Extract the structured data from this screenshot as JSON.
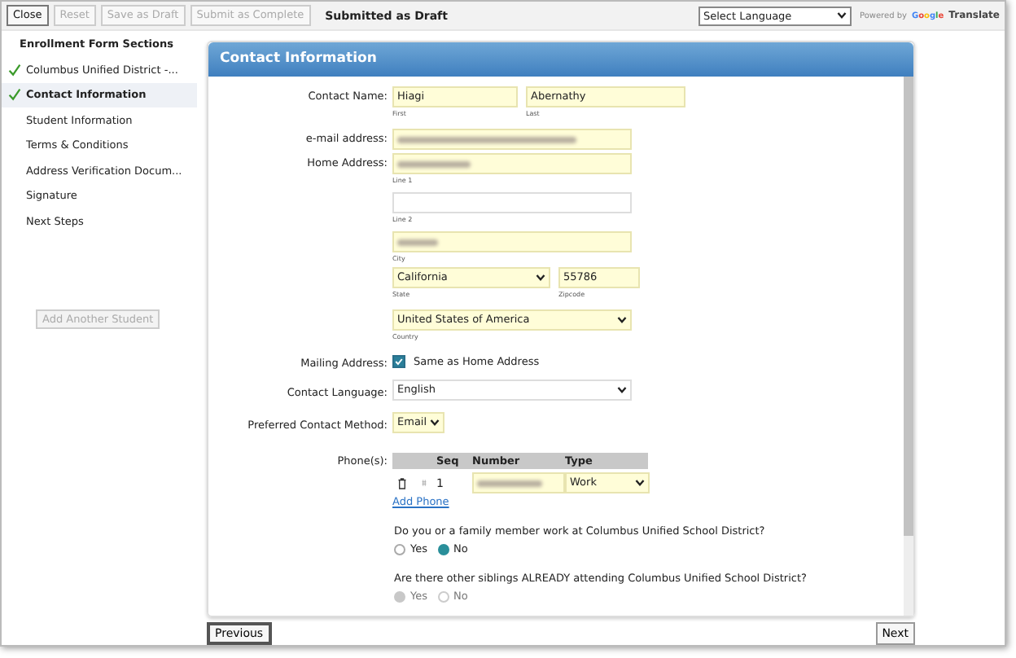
{
  "toolbar": {
    "buttons": [
      {
        "label": "Close",
        "disabled": false
      },
      {
        "label": "Reset",
        "disabled": true
      },
      {
        "label": "Save as Draft",
        "disabled": true
      },
      {
        "label": "Submit as Complete",
        "disabled": true
      }
    ],
    "status": "Submitted as Draft",
    "language_select": "Select Language",
    "powered_by": "Powered by",
    "google": "Google",
    "translate": "Translate"
  },
  "sidebar": {
    "title": "Enrollment Form Sections",
    "items": [
      {
        "label": "Columbus Unified District -...",
        "checked": true,
        "selected": false
      },
      {
        "label": "Contact Information",
        "checked": true,
        "selected": true
      },
      {
        "label": "Student Information",
        "checked": false,
        "selected": false
      },
      {
        "label": "Terms & Conditions",
        "checked": false,
        "selected": false
      },
      {
        "label": "Address Verification Docum...",
        "checked": false,
        "selected": false
      },
      {
        "label": "Signature",
        "checked": false,
        "selected": false
      },
      {
        "label": "Next Steps",
        "checked": false,
        "selected": false
      }
    ],
    "add_button": {
      "label": "Add Another Student",
      "disabled": true
    }
  },
  "panel": {
    "title": "Contact Information",
    "contact_name": {
      "label": "Contact Name:",
      "first": {
        "value": "Hiagi",
        "hint": "First"
      },
      "last": {
        "value": "Abernathy",
        "hint": "Last"
      }
    },
    "email": {
      "label": "e-mail address:",
      "redacted": true
    },
    "home_address": {
      "label": "Home Address:",
      "line1": {
        "hint": "Line 1",
        "redacted": true
      },
      "line2": {
        "hint": "Line 2",
        "redacted": false
      },
      "city": {
        "hint": "City",
        "redacted": true
      },
      "state": {
        "value": "California",
        "hint": "State"
      },
      "zip": {
        "value": "55786",
        "hint": "Zipcode"
      },
      "country": {
        "value": "United States of America",
        "hint": "Country"
      }
    },
    "mailing": {
      "label": "Mailing Address:",
      "checked": true,
      "text": "Same as Home Address"
    },
    "language": {
      "label": "Contact Language:",
      "value": "English"
    },
    "method": {
      "label": "Preferred Contact Method:",
      "value": "Email"
    },
    "phones": {
      "label": "Phone(s):",
      "columns": [
        "Seq",
        "Number",
        "Type"
      ],
      "rows": [
        {
          "seq": "1",
          "redacted": true,
          "type": "Work"
        }
      ],
      "add": "Add Phone"
    },
    "questions": [
      {
        "text": "Do you or a family member work at Columbus Unified School District?",
        "options": [
          {
            "label": "Yes",
            "selected": false,
            "disabled": false
          },
          {
            "label": "No",
            "selected": true,
            "disabled": false
          }
        ]
      },
      {
        "text": "Are there other siblings ALREADY attending Columbus Unified School District?",
        "options": [
          {
            "label": "Yes",
            "selected": true,
            "disabled": true
          },
          {
            "label": "No",
            "selected": false,
            "disabled": true
          }
        ]
      }
    ]
  },
  "footer": {
    "previous": "Previous",
    "next": "Next"
  }
}
